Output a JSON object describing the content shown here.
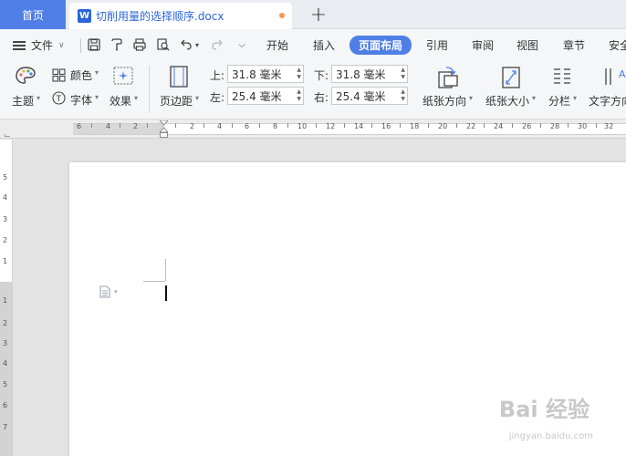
{
  "tabs": {
    "home_label": "首页",
    "doc_icon_letter": "W",
    "doc_title": "切削用量的选择顺序.docx",
    "new_tab_symbol": "+"
  },
  "menu": {
    "file_label": "文件",
    "tabs": [
      "开始",
      "插入",
      "页面布局",
      "引用",
      "审阅",
      "视图",
      "章节",
      "安全"
    ],
    "active_tab": "页面布局"
  },
  "ribbon": {
    "theme_label": "主题",
    "color_label": "颜色",
    "font_label": "字体",
    "effect_label": "效果",
    "margins_label": "页边距",
    "margin_top_label": "上:",
    "margin_top_value": "31.8 毫米",
    "margin_bottom_label": "下:",
    "margin_bottom_value": "31.8 毫米",
    "margin_left_label": "左:",
    "margin_left_value": "25.4 毫米",
    "margin_right_label": "右:",
    "margin_right_value": "25.4 毫米",
    "orientation_label": "纸张方向",
    "size_label": "纸张大小",
    "columns_label": "分栏",
    "text_direction_label": "文字方向"
  },
  "ruler": {
    "h_ticks": [
      "6",
      "4",
      "2",
      "2",
      "4",
      "6",
      "8",
      "10",
      "12",
      "14",
      "16",
      "18",
      "20",
      "22",
      "24",
      "26",
      "28",
      "30",
      "32"
    ],
    "v_ticks": [
      "5",
      "4",
      "3",
      "2",
      "1",
      "1",
      "2",
      "3",
      "4",
      "5",
      "6",
      "7"
    ]
  },
  "watermark": {
    "text": "Bai 经验",
    "url": "jingyan.baidu.com"
  }
}
